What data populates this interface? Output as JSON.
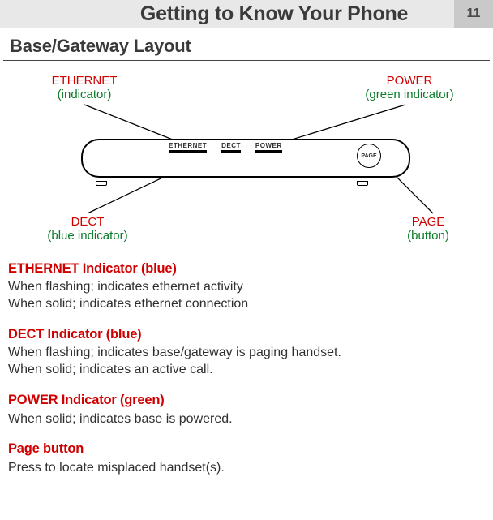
{
  "header": {
    "chapter_title": "Getting to Know Your Phone",
    "page_number": "11"
  },
  "section_title": "Base/Gateway Layout",
  "diagram": {
    "callouts": {
      "ethernet": {
        "name": "ETHERNET",
        "note": "(indicator)"
      },
      "power": {
        "name": "POWER",
        "note": "(green indicator)"
      },
      "dect": {
        "name": "DECT",
        "note": "(blue indicator)"
      },
      "page": {
        "name": "PAGE",
        "note": "(button)"
      }
    },
    "device_labels": {
      "ethernet": "ETHERNET",
      "dect": "DECT",
      "power": "POWER",
      "page": "PAGE"
    }
  },
  "descriptions": [
    {
      "title": "ETHERNET Indicator  (blue)",
      "lines": [
        "When flashing; indicates ethernet activity",
        "When solid; indicates ethernet connection"
      ]
    },
    {
      "title": "DECT Indicator  (blue)",
      "lines": [
        "When flashing; indicates base/gateway is paging handset.",
        "When solid; indicates an active call."
      ]
    },
    {
      "title": "POWER Indicator  (green)",
      "lines": [
        "When solid; indicates base is powered."
      ]
    },
    {
      "title": "Page button",
      "lines": [
        "Press to locate misplaced handset(s)."
      ]
    }
  ]
}
